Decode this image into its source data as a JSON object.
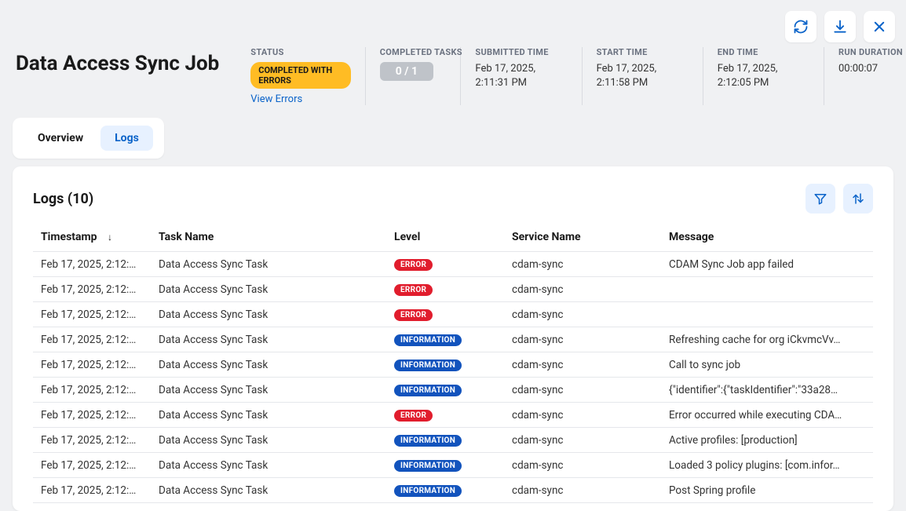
{
  "header": {
    "title": "Data Access Sync Job",
    "status_label": "STATUS",
    "status_value": "COMPLETED WITH ERRORS",
    "view_errors": "View Errors",
    "tasks_label": "COMPLETED TASKS",
    "tasks_value": "0 / 1",
    "submitted_label": "SUBMITTED TIME",
    "submitted_value": "Feb 17, 2025, 2:11:31 PM",
    "start_label": "START TIME",
    "start_value": "Feb 17, 2025, 2:11:58 PM",
    "end_label": "END TIME",
    "end_value": "Feb 17, 2025, 2:12:05 PM",
    "duration_label": "RUN DURATION",
    "duration_value": "00:00:07"
  },
  "tabs": {
    "overview": "Overview",
    "logs": "Logs"
  },
  "logs": {
    "title": "Logs (10)",
    "columns": {
      "timestamp": "Timestamp",
      "task": "Task Name",
      "level": "Level",
      "service": "Service Name",
      "message": "Message"
    },
    "rows": [
      {
        "ts": "Feb 17, 2025, 2:12:…",
        "task": "Data Access Sync Task",
        "level": "ERROR",
        "service": "cdam-sync",
        "msg": "CDAM Sync Job app failed"
      },
      {
        "ts": "Feb 17, 2025, 2:12:…",
        "task": "Data Access Sync Task",
        "level": "ERROR",
        "service": "cdam-sync",
        "msg": ""
      },
      {
        "ts": "Feb 17, 2025, 2:12:…",
        "task": "Data Access Sync Task",
        "level": "ERROR",
        "service": "cdam-sync",
        "msg": ""
      },
      {
        "ts": "Feb 17, 2025, 2:12:…",
        "task": "Data Access Sync Task",
        "level": "INFORMATION",
        "service": "cdam-sync",
        "msg": "Refreshing cache for org iCkvmcVv…"
      },
      {
        "ts": "Feb 17, 2025, 2:12:…",
        "task": "Data Access Sync Task",
        "level": "INFORMATION",
        "service": "cdam-sync",
        "msg": "Call to sync job"
      },
      {
        "ts": "Feb 17, 2025, 2:12:…",
        "task": "Data Access Sync Task",
        "level": "INFORMATION",
        "service": "cdam-sync",
        "msg": "{\"identifier\":{\"taskIdentifier\":\"33a28…"
      },
      {
        "ts": "Feb 17, 2025, 2:12:…",
        "task": "Data Access Sync Task",
        "level": "ERROR",
        "service": "cdam-sync",
        "msg": "Error occurred while executing CDA…"
      },
      {
        "ts": "Feb 17, 2025, 2:12:…",
        "task": "Data Access Sync Task",
        "level": "INFORMATION",
        "service": "cdam-sync",
        "msg": "Active profiles: [production]"
      },
      {
        "ts": "Feb 17, 2025, 2:12:…",
        "task": "Data Access Sync Task",
        "level": "INFORMATION",
        "service": "cdam-sync",
        "msg": "Loaded 3 policy plugins: [com.infor…"
      },
      {
        "ts": "Feb 17, 2025, 2:12:…",
        "task": "Data Access Sync Task",
        "level": "INFORMATION",
        "service": "cdam-sync",
        "msg": "Post Spring profile"
      }
    ]
  }
}
